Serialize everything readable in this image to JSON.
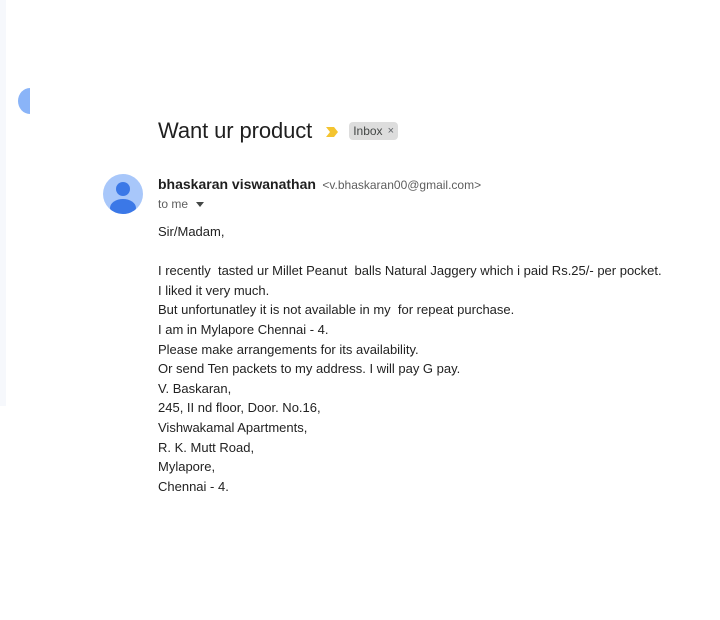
{
  "email": {
    "subject": "Want ur product",
    "label": "Inbox",
    "label_close": "×",
    "sender_name": "bhaskaran viswanathan",
    "sender_email": "<v.bhaskaran00@gmail.com>",
    "recipient": "to me",
    "body_lines": [
      "Sir/Madam,",
      "",
      "I recently  tasted ur Millet Peanut  balls Natural Jaggery which i paid Rs.25/- per pocket.",
      "I liked it very much.",
      "But unfortunatley it is not available in my  for repeat purchase.",
      "I am in Mylapore Chennai - 4.",
      "Please make arrangements for its availability.",
      "Or send Ten packets to my address. I will pay G pay.",
      "V. Baskaran,",
      "245, II nd floor, Door. No.16,",
      "Vishwakamal Apartments,",
      "R. K. Mutt Road,",
      "Mylapore,",
      "Chennai - 4."
    ]
  },
  "icons": {
    "importance": "importance-marker-icon",
    "avatar": "person-avatar-icon",
    "caret": "chevron-down-icon"
  },
  "colors": {
    "importance": "#f4c430",
    "avatar_bg": "#a8c7fa",
    "avatar_fg": "#3b78e7"
  }
}
